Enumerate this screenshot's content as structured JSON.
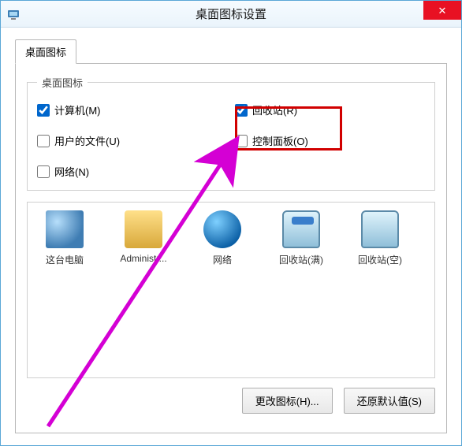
{
  "window": {
    "title": "桌面图标设置",
    "close_glyph": "✕"
  },
  "tabs": {
    "main": "桌面图标"
  },
  "group": {
    "legend": "桌面图标",
    "items": [
      {
        "label": "计算机(M)",
        "checked": true
      },
      {
        "label": "回收站(R)",
        "checked": true
      },
      {
        "label": "用户的文件(U)",
        "checked": false
      },
      {
        "label": "控制面板(O)",
        "checked": false
      },
      {
        "label": "网络(N)",
        "checked": false
      }
    ]
  },
  "icons": [
    {
      "label": "这台电脑",
      "kind": "pc"
    },
    {
      "label": "Administr...",
      "kind": "folder"
    },
    {
      "label": "网络",
      "kind": "globe"
    },
    {
      "label": "回收站(满)",
      "kind": "bin-full"
    },
    {
      "label": "回收站(空)",
      "kind": "bin-empty"
    }
  ],
  "buttons": {
    "change_icon": "更改图标(H)...",
    "restore_default": "还原默认值(S)"
  }
}
